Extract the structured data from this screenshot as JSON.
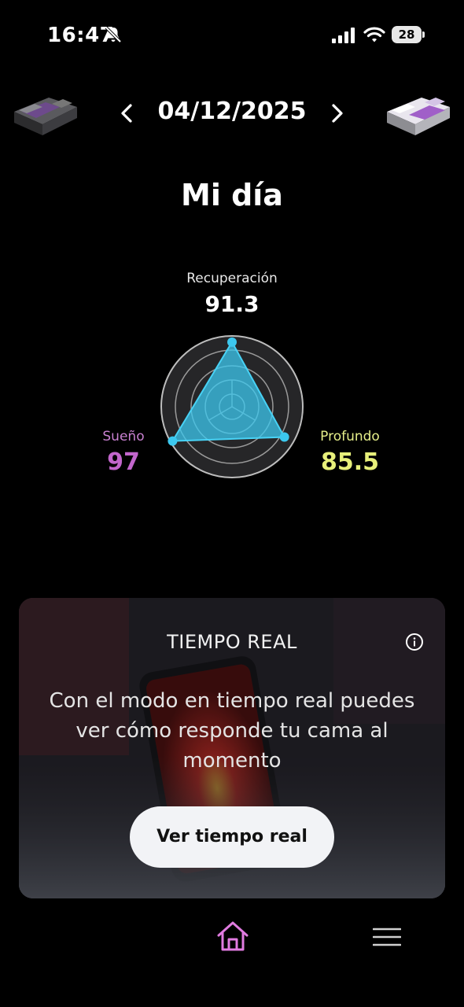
{
  "status_bar": {
    "time": "16:47",
    "battery": "28"
  },
  "header": {
    "date": "04/12/2025",
    "title": "Mi día"
  },
  "radar": {
    "scores": [
      {
        "label": "Recuperación",
        "value": "91.3"
      },
      {
        "label": "Sueño",
        "value": "97"
      },
      {
        "label": "Profundo",
        "value": "85.5"
      }
    ],
    "colors": {
      "fill": "#3cc8ef",
      "sueno": "#c266cc",
      "profundo": "#e8f07a"
    }
  },
  "realtime_card": {
    "title": "TIEMPO REAL",
    "description": "Con el modo en tiempo real puedes ver cómo responde tu cama al momento",
    "button_label": "Ver tiempo real"
  },
  "colors": {
    "accent_home": "#e07be0"
  }
}
